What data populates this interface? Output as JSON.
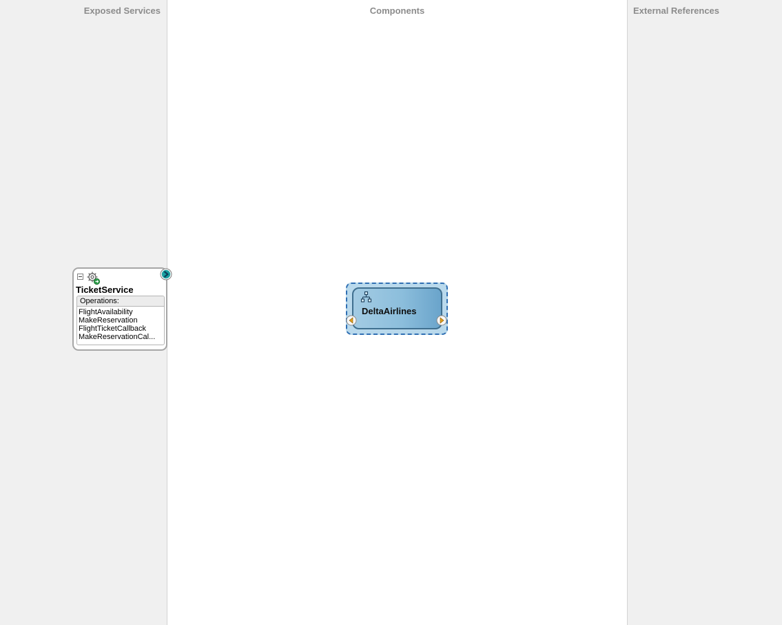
{
  "lanes": {
    "left_title": "Exposed Services",
    "center_title": "Components",
    "right_title": "External References"
  },
  "service": {
    "name": "TicketService",
    "icon": "gear-icon",
    "ops_header": "Operations:",
    "operations": [
      "FlightAvailability",
      "MakeReservation",
      "FlightTicketCallback",
      "MakeReservationCal..."
    ]
  },
  "component": {
    "name": "DeltaAirlines",
    "icon": "process-tree-icon"
  },
  "colors": {
    "lane_bg": "#f0f0f0",
    "component_fill": "#8cbedc",
    "component_border": "#2f6fb3",
    "service_port": "#1aa0a0",
    "port_arrow": "#e0a020"
  }
}
